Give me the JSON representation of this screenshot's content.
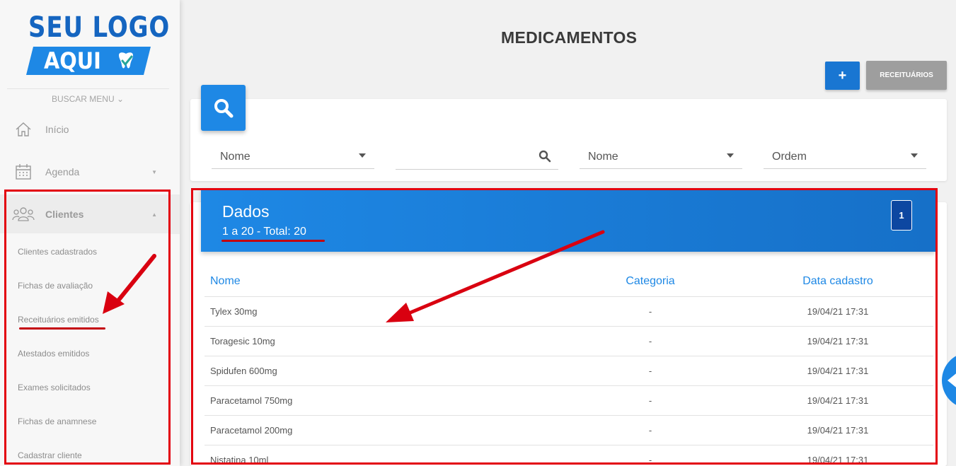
{
  "logo": {
    "top": "SEU LOGO",
    "bottom": "AQUI"
  },
  "sidebar": {
    "search_menu": "BUSCAR MENU",
    "items": [
      {
        "label": "Início",
        "icon": "home-icon"
      },
      {
        "label": "Agenda",
        "icon": "calendar-icon"
      },
      {
        "label": "Clientes",
        "icon": "users-icon"
      }
    ],
    "sub_items": [
      "Clientes cadastrados",
      "Fichas de avaliação",
      "Receituários emitidos",
      "Atestados emitidos",
      "Exames solicitados",
      "Fichas de anamnese",
      "Cadastrar cliente"
    ]
  },
  "header": {
    "title": "MEDICAMENTOS",
    "add_label": "+",
    "receituarios_label": "RECEITUÁRIOS"
  },
  "filters": {
    "field": "Nome",
    "search_value": "",
    "sort_field": "Nome",
    "order": "Ordem"
  },
  "data": {
    "title": "Dados",
    "range": "1 a 20 - Total: 20",
    "page": "1",
    "columns": [
      "Nome",
      "Categoria",
      "Data cadastro"
    ],
    "rows": [
      [
        "Tylex 30mg",
        "-",
        "19/04/21 17:31"
      ],
      [
        "Toragesic 10mg",
        "-",
        "19/04/21 17:31"
      ],
      [
        "Spidufen 600mg",
        "-",
        "19/04/21 17:31"
      ],
      [
        "Paracetamol 750mg",
        "-",
        "19/04/21 17:31"
      ],
      [
        "Paracetamol 200mg",
        "-",
        "19/04/21 17:31"
      ],
      [
        "Nistatina 10ml",
        "-",
        "19/04/21 17:31"
      ]
    ]
  },
  "colors": {
    "primary": "#1e88e5",
    "dark_primary": "#1565c0",
    "annotation": "#e3000f",
    "grey_button": "#9e9e9e"
  }
}
